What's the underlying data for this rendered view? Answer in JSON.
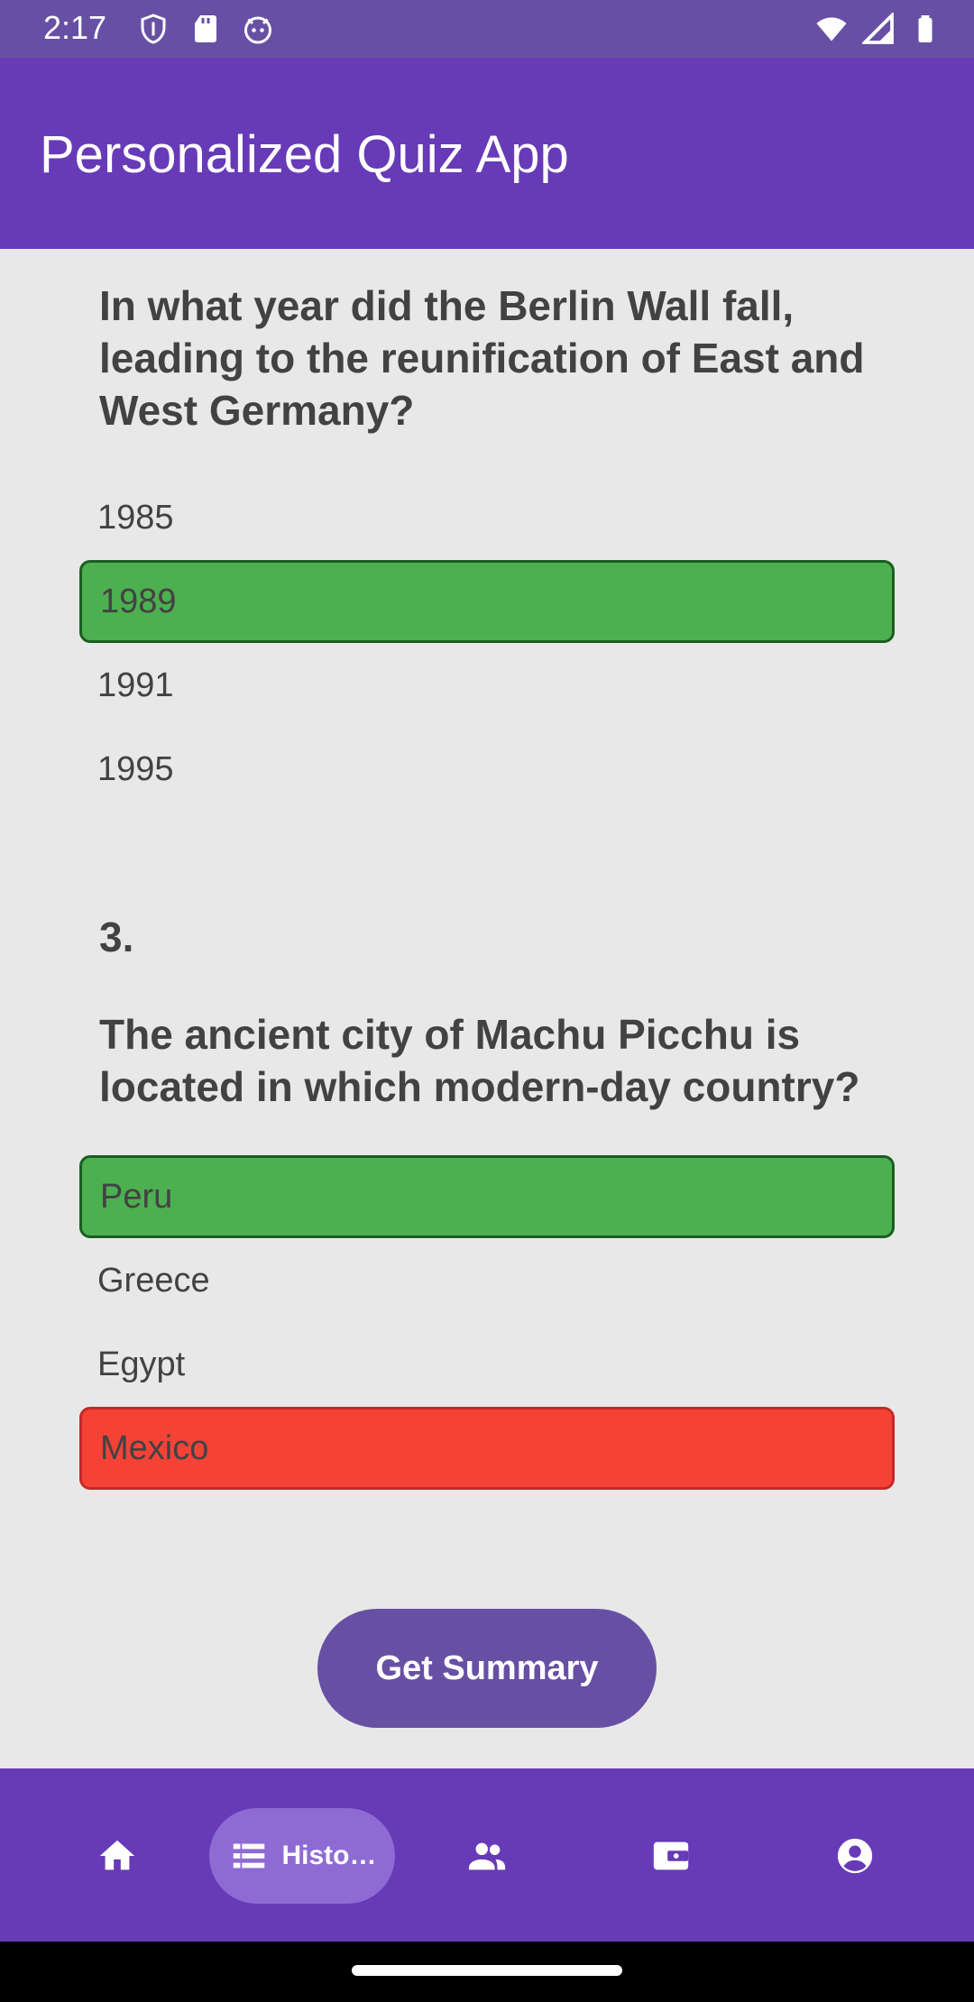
{
  "status_bar": {
    "time": "2:17",
    "icons_left": [
      "shield-icon",
      "sd-card-icon",
      "android-face-icon"
    ],
    "icons_right": [
      "wifi-icon",
      "cell-signal-icon",
      "battery-icon"
    ]
  },
  "app_bar": {
    "title": "Personalized Quiz App"
  },
  "questions": [
    {
      "text": "In what year did the Berlin Wall fall, leading to the reunification of East and West Germany?",
      "options": [
        {
          "label": "1985",
          "state": "none"
        },
        {
          "label": "1989",
          "state": "correct"
        },
        {
          "label": "1991",
          "state": "none"
        },
        {
          "label": "1995",
          "state": "none"
        }
      ]
    },
    {
      "number": "3.",
      "text": "The ancient city of Machu Picchu is located in which modern-day country?",
      "options": [
        {
          "label": "Peru",
          "state": "correct"
        },
        {
          "label": "Greece",
          "state": "none"
        },
        {
          "label": "Egypt",
          "state": "none"
        },
        {
          "label": "Mexico",
          "state": "wrong"
        }
      ]
    }
  ],
  "summary_button": {
    "label": "Get Summary"
  },
  "bottom_nav": {
    "items": [
      {
        "icon": "home-icon",
        "label": ""
      },
      {
        "icon": "list-icon",
        "label": "Histo…",
        "active": true
      },
      {
        "icon": "people-icon",
        "label": ""
      },
      {
        "icon": "wallet-icon",
        "label": ""
      },
      {
        "icon": "account-circle-icon",
        "label": ""
      }
    ]
  },
  "colors": {
    "status_bar": "#6750a4",
    "app_bar": "#673ab7",
    "background": "#e8e8e8",
    "correct": "#4caf50",
    "wrong": "#f44336",
    "button": "#6750a4",
    "nav_active_pill": "#8e6bd3",
    "text": "#424242"
  }
}
